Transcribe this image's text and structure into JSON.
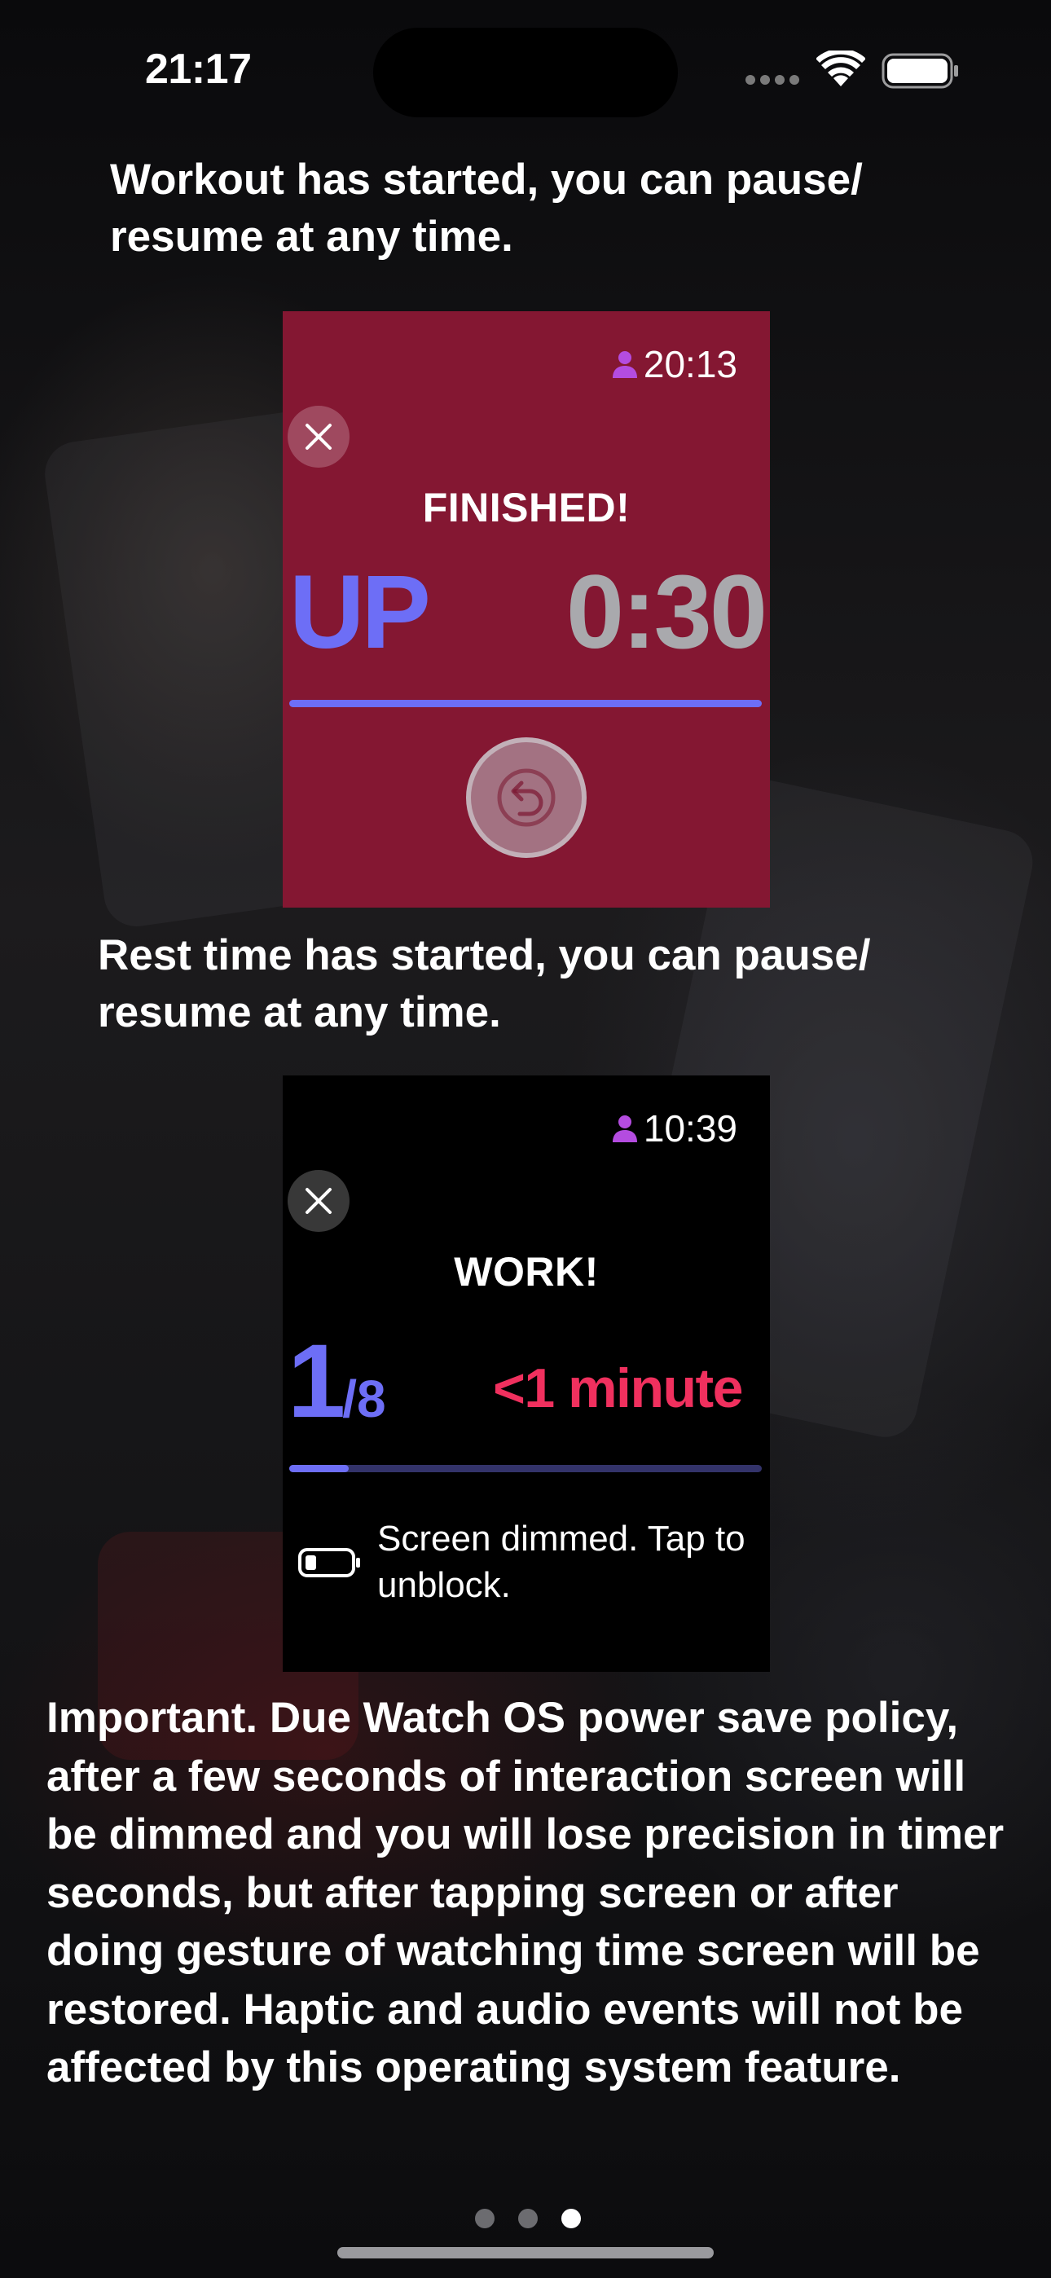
{
  "status_bar": {
    "time": "21:17",
    "icons": [
      "cellular-signal-icon",
      "wifi-icon",
      "battery-icon"
    ]
  },
  "captions": {
    "top_line_1": "Workout has started, you can pause/",
    "top_line_2": "resume at any time.",
    "middle": "Rest time has started, you can pause/ resume at any time.",
    "bottom": "Important. Due Watch OS power save policy, after a few seconds of interaction screen will be dimmed and you will lose precision in timer seconds, but after tapping screen or after doing gesture of watching time screen will be restored. Haptic and audio events will not be affected by this operating system feature."
  },
  "watch_rest": {
    "clock": "20:13",
    "title": "FINISHED!",
    "phase": "UP",
    "timer": "0:30",
    "progress": 1.0,
    "background_color": "#841732",
    "accent_color": "#6d6ef6",
    "icons": [
      "person-icon",
      "close-icon",
      "undo-arrow-icon"
    ]
  },
  "watch_work": {
    "clock": "10:39",
    "title": "WORK!",
    "round_current": "1",
    "round_total": "/8",
    "remaining": "<1 minute",
    "progress": 0.125,
    "dim_message": "Screen dimmed. Tap to unblock.",
    "accent_color": "#6d6ef6",
    "remaining_color": "#f0305e",
    "icons": [
      "person-icon",
      "close-icon",
      "low-battery-icon"
    ]
  },
  "pager": {
    "count": 3,
    "active_index": 2
  }
}
